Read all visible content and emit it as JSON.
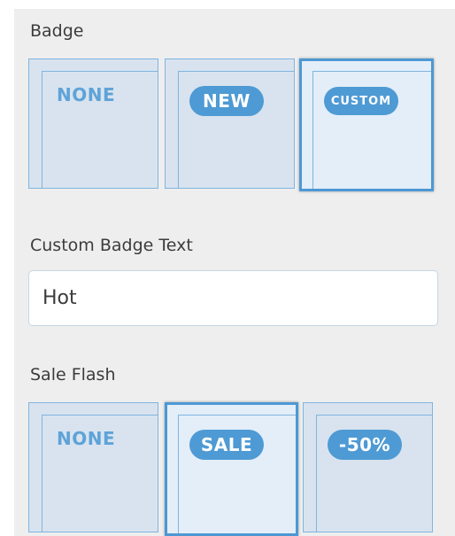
{
  "badge": {
    "label": "Badge",
    "options": [
      {
        "type": "none",
        "text": "NONE",
        "selected": false
      },
      {
        "type": "new",
        "text": "NEW",
        "selected": false
      },
      {
        "type": "custom",
        "text": "CUSTOM",
        "selected": true
      }
    ]
  },
  "custom_badge_text": {
    "label": "Custom Badge Text",
    "value": "Hot"
  },
  "sale_flash": {
    "label": "Sale Flash",
    "options": [
      {
        "type": "none",
        "text": "NONE",
        "selected": false
      },
      {
        "type": "sale",
        "text": "SALE",
        "selected": true
      },
      {
        "type": "percent",
        "text": "-50%",
        "selected": false
      }
    ]
  },
  "colors": {
    "accent": "#4e9ad4",
    "option_border": "#7fb5e0",
    "option_bg": "#d8e3ef",
    "selected_bg": "#e3eef9",
    "panel_bg": "#eeeeee"
  }
}
